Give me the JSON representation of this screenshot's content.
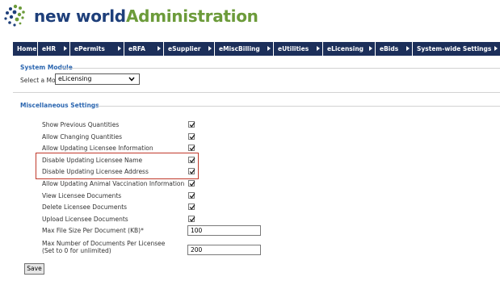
{
  "header": {
    "logo_word_1": "new world",
    "logo_word_2": "Administration",
    "logo_icon": "dotted-swirl-logo-icon"
  },
  "nav": {
    "items": [
      {
        "label": "Home",
        "has_arrow": false
      },
      {
        "label": "eHR",
        "has_arrow": true
      },
      {
        "label": "ePermits",
        "has_arrow": true
      },
      {
        "label": "eRFA",
        "has_arrow": true
      },
      {
        "label": "eSupplier",
        "has_arrow": true
      },
      {
        "label": "eMiscBilling",
        "has_arrow": true
      },
      {
        "label": "eUtilities",
        "has_arrow": true
      },
      {
        "label": "eLicensing",
        "has_arrow": true
      },
      {
        "label": "eBids",
        "has_arrow": true
      },
      {
        "label": "System-wide Settings",
        "has_arrow": true
      }
    ]
  },
  "system_module": {
    "title": "System Module",
    "select_label": "Select a Module",
    "selected_value": "eLicensing"
  },
  "misc_settings": {
    "title": "Miscellaneous Settings",
    "rows": [
      {
        "label": "Show Previous Quantities",
        "checked": true
      },
      {
        "label": "Allow Changing Quantities",
        "checked": true
      },
      {
        "label": "Allow Updating Licensee Information",
        "checked": true
      },
      {
        "label": "Disable Updating Licensee Name",
        "checked": true,
        "highlighted": true
      },
      {
        "label": "Disable Updating Licensee Address",
        "checked": true,
        "highlighted": true
      },
      {
        "label": "Allow Updating Animal Vaccination Information",
        "checked": true
      },
      {
        "label": "View Licensee Documents",
        "checked": true
      },
      {
        "label": "Delete Licensee Documents",
        "checked": true
      },
      {
        "label": "Upload Licensee Documents",
        "checked": true
      }
    ],
    "max_file_size": {
      "label": "Max File Size Per Document (KB)*",
      "value": "100"
    },
    "max_docs": {
      "label_line_1": "Max Number of Documents Per Licensee",
      "label_line_2": "(Set to 0 for unlimited)",
      "value": "200"
    }
  },
  "actions": {
    "save_label": "Save"
  },
  "colors": {
    "nav_bg": "#1c2f5a",
    "section_title": "#2b66b0",
    "logo_blue": "#1e3f7a",
    "logo_green": "#6c9b3a",
    "highlight_border": "#c0392b"
  }
}
